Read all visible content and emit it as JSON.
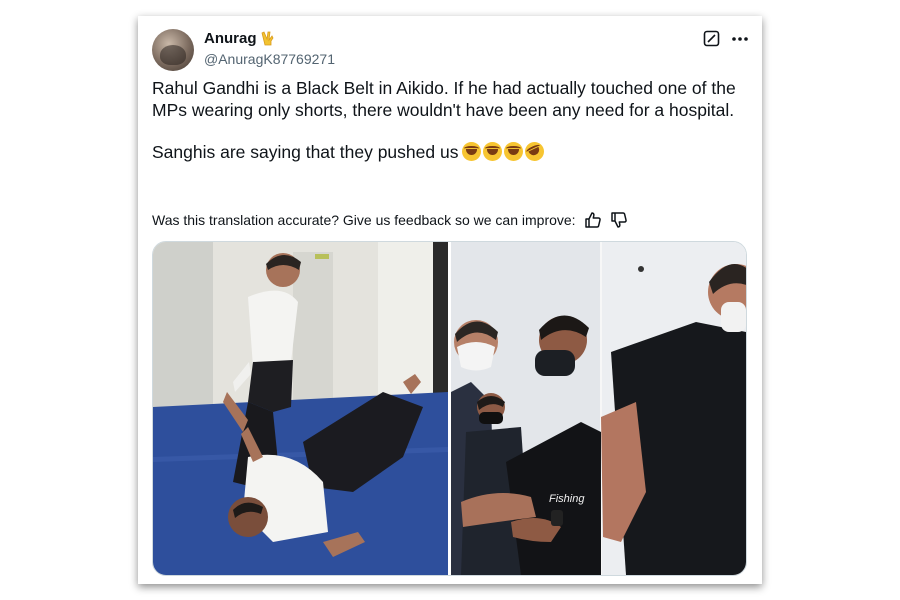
{
  "author": {
    "display_name": "Anurag",
    "badge_icon": "victory-hand-emoji",
    "handle": "@AnuragK87769271"
  },
  "tweet": {
    "paragraphs": [
      "Rahul Gandhi is a Black Belt in Aikido. If he had actually touched one of the MPs wearing only shorts, there wouldn't have been any need for a hospital.",
      "Sanghis are saying that they pushed us"
    ],
    "emojis": [
      "face-with-tears-of-joy",
      "face-with-tears-of-joy",
      "face-with-tears-of-joy",
      "rolling-on-the-floor-laughing"
    ]
  },
  "translation_feedback": {
    "prompt": "Was this translation accurate? Give us feedback so we can improve:",
    "icons": [
      "thumbs-up-icon",
      "thumbs-down-icon"
    ]
  },
  "actions": {
    "icons": [
      "grok-icon",
      "more-options-icon"
    ]
  },
  "media": {
    "images": [
      {
        "name": "aikido-photo",
        "shirt_text": ""
      },
      {
        "name": "group-masks-photo",
        "shirt_text": "Fishing"
      }
    ]
  },
  "colors": {
    "text": "#0f1419",
    "secondary": "#536471",
    "mat": "#2e4f9c",
    "border": "#cfd9de"
  }
}
